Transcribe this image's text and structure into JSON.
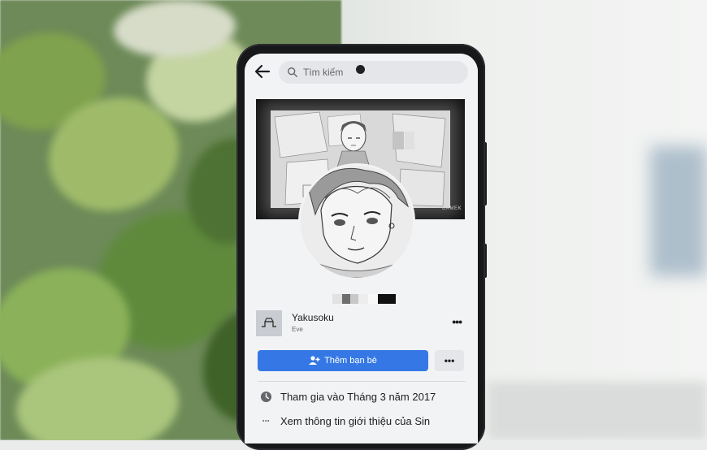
{
  "search": {
    "placeholder": "Tìm kiếm"
  },
  "cover": {
    "watermark": "GAMEK"
  },
  "music": {
    "title": "Yakusoku",
    "artist": "Eve",
    "more": "•••"
  },
  "actions": {
    "add_friend_label": "Thêm bạn bè",
    "more_label": "•••"
  },
  "intro": {
    "joined": "Tham gia vào Tháng 3 năm 2017",
    "see_more": "Xem thông tin giới thiệu của Sin"
  },
  "colors": {
    "primary_button": "#3578e5",
    "screen_bg": "#f2f3f5",
    "text": "#1c1e21"
  }
}
